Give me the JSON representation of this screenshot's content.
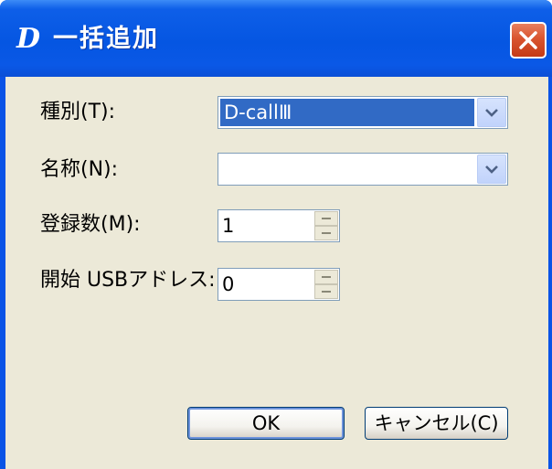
{
  "window": {
    "title": "一括追加",
    "title_icon_glyph": "D",
    "icon": "app-d-logo-icon",
    "close_icon": "close-icon"
  },
  "form": {
    "type": {
      "label": "種別(T):",
      "value": "D-callⅢ",
      "selected": true
    },
    "name": {
      "label": "名称(N):",
      "value": ""
    },
    "count": {
      "label": "登録数(M):",
      "value": "1"
    },
    "usb_address": {
      "label": "開始 USBアドレス:",
      "value": "0"
    }
  },
  "buttons": {
    "ok": "OK",
    "cancel": "キャンセル(C)"
  },
  "colors": {
    "titlebar": "#0556e2",
    "client_bg": "#ece9d8",
    "selection": "#316ac5",
    "close_button": "#d9542f"
  }
}
